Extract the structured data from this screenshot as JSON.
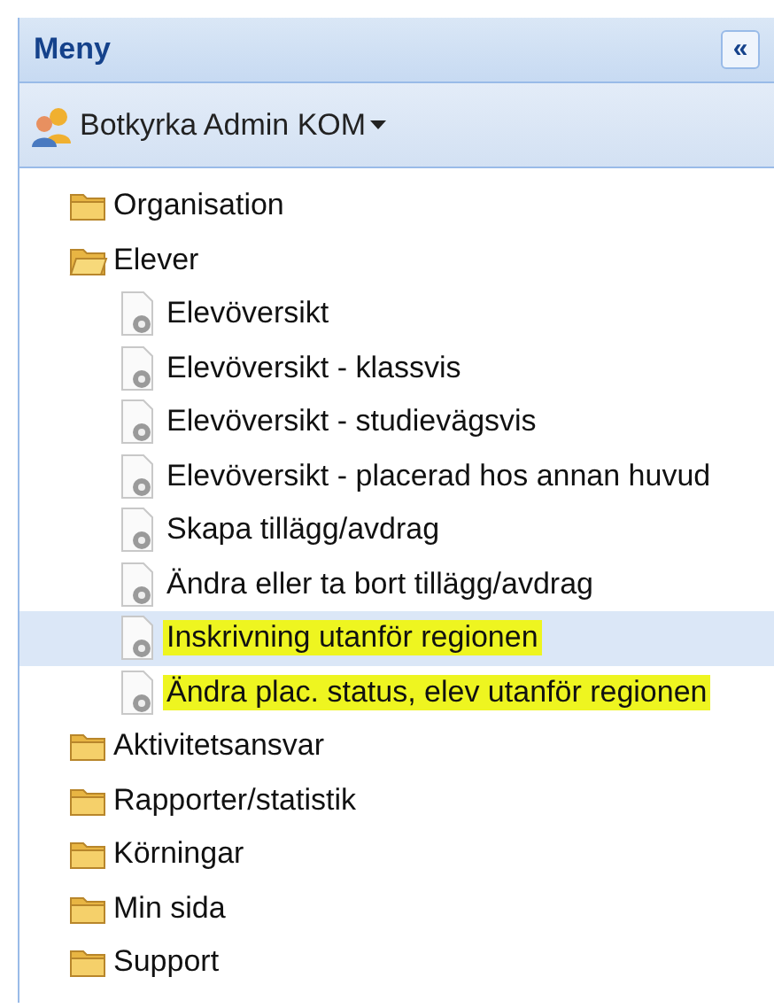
{
  "panel": {
    "title": "Meny",
    "collapse_button": "«"
  },
  "user": {
    "name": "Botkyrka Admin KOM"
  },
  "tree": [
    {
      "label": "Organisation",
      "expanded": false
    },
    {
      "label": "Elever",
      "expanded": true,
      "children": [
        {
          "label": "Elevöversikt",
          "selected": false,
          "highlighted": false
        },
        {
          "label": "Elevöversikt - klassvis",
          "selected": false,
          "highlighted": false
        },
        {
          "label": "Elevöversikt - studievägsvis",
          "selected": false,
          "highlighted": false
        },
        {
          "label": "Elevöversikt - placerad hos annan huvud",
          "selected": false,
          "highlighted": false
        },
        {
          "label": "Skapa tillägg/avdrag",
          "selected": false,
          "highlighted": false
        },
        {
          "label": "Ändra eller ta bort tillägg/avdrag",
          "selected": false,
          "highlighted": false
        },
        {
          "label": "Inskrivning utanför regionen",
          "selected": true,
          "highlighted": true
        },
        {
          "label": "Ändra plac. status, elev utanför regionen",
          "selected": false,
          "highlighted": true
        }
      ]
    },
    {
      "label": "Aktivitetsansvar",
      "expanded": false
    },
    {
      "label": "Rapporter/statistik",
      "expanded": false
    },
    {
      "label": "Körningar",
      "expanded": false
    },
    {
      "label": "Min sida",
      "expanded": false
    },
    {
      "label": "Support",
      "expanded": false
    }
  ]
}
